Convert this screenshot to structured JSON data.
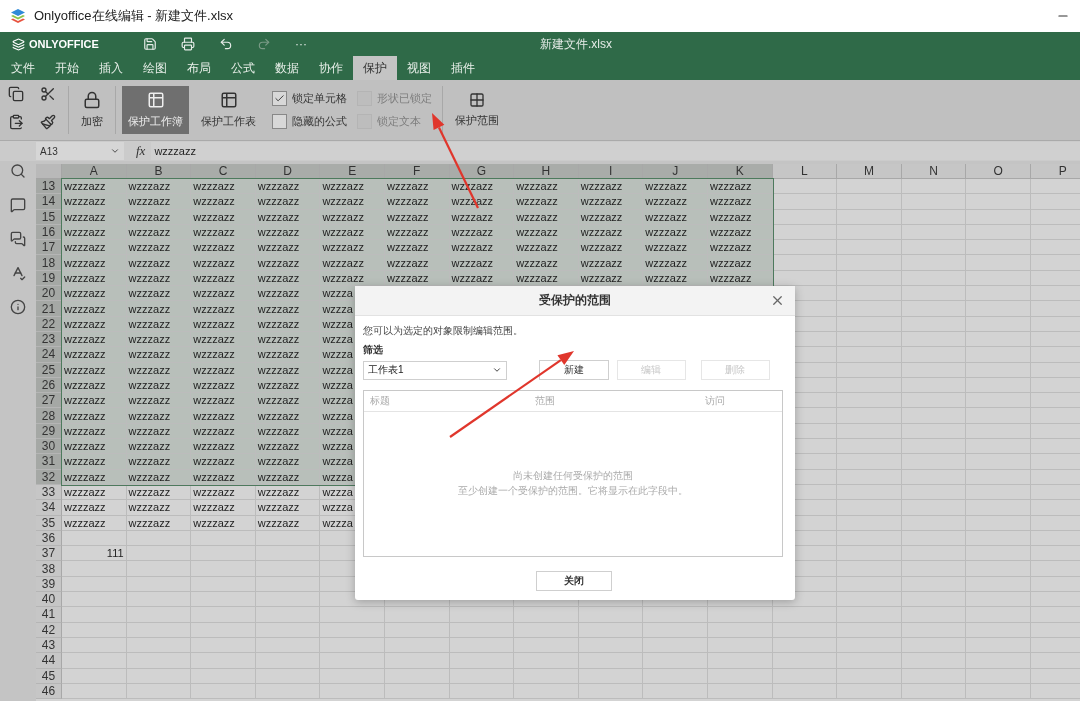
{
  "window": {
    "title": "Onlyoffice在线编辑 - 新建文件.xlsx"
  },
  "header": {
    "logo": "ONLYOFFICE",
    "document": "新建文件.xlsx",
    "more": "···",
    "quick_actions": [
      {
        "kind": "save",
        "disabled": false
      },
      {
        "kind": "print",
        "disabled": false
      },
      {
        "kind": "undo",
        "disabled": false
      },
      {
        "kind": "redo",
        "disabled": true
      }
    ]
  },
  "tabs": [
    {
      "label": "文件",
      "selected": false
    },
    {
      "label": "开始",
      "selected": false
    },
    {
      "label": "插入",
      "selected": false
    },
    {
      "label": "绘图",
      "selected": false
    },
    {
      "label": "布局",
      "selected": false
    },
    {
      "label": "公式",
      "selected": false
    },
    {
      "label": "数据",
      "selected": false
    },
    {
      "label": "协作",
      "selected": false
    },
    {
      "label": "保护",
      "selected": true
    },
    {
      "label": "视图",
      "selected": false
    },
    {
      "label": "插件",
      "selected": false
    }
  ],
  "toolbar": {
    "encrypt": "加密",
    "protect_range": "保护范围",
    "buttons": [
      {
        "label": "保护工作簿",
        "pressed": true
      },
      {
        "label": "保护工作表",
        "pressed": false
      }
    ],
    "options": [
      {
        "label": "锁定单元格",
        "checked": true,
        "disabled": false
      },
      {
        "label": "隐藏的公式",
        "checked": false,
        "disabled": false
      },
      {
        "label": "形状已锁定",
        "checked": false,
        "disabled": true
      },
      {
        "label": "锁定文本",
        "checked": false,
        "disabled": true
      }
    ]
  },
  "formula_bar": {
    "cell": "A13",
    "fx": "fx",
    "value": "wzzzazz"
  },
  "sheet": {
    "columns": [
      {
        "label": "A",
        "selected": true
      },
      {
        "label": "B",
        "selected": true
      },
      {
        "label": "C",
        "selected": true
      },
      {
        "label": "D",
        "selected": true
      },
      {
        "label": "E",
        "selected": true
      },
      {
        "label": "F",
        "selected": true
      },
      {
        "label": "G",
        "selected": true
      },
      {
        "label": "H",
        "selected": true
      },
      {
        "label": "I",
        "selected": true
      },
      {
        "label": "J",
        "selected": true
      },
      {
        "label": "K",
        "selected": true
      },
      {
        "label": "L",
        "selected": false
      },
      {
        "label": "M",
        "selected": false
      },
      {
        "label": "N",
        "selected": false
      },
      {
        "label": "O",
        "selected": false
      },
      {
        "label": "P",
        "selected": false
      }
    ],
    "rows": [
      {
        "header": "13",
        "selected": true,
        "cells": [
          "wzzzazz",
          "wzzzazz",
          "wzzzazz",
          "wzzzazz",
          "wzzzazz",
          "wzzzazz",
          "wzzzazz",
          "wzzzazz",
          "wzzzazz",
          "wzzzazz",
          "wzzzazz"
        ]
      },
      {
        "header": "14",
        "selected": true,
        "cells": [
          "wzzzazz",
          "wzzzazz",
          "wzzzazz",
          "wzzzazz",
          "wzzzazz",
          "wzzzazz",
          "wzzzazz",
          "wzzzazz",
          "wzzzazz",
          "wzzzazz",
          "wzzzazz"
        ]
      },
      {
        "header": "15",
        "selected": true,
        "cells": [
          "wzzzazz",
          "wzzzazz",
          "wzzzazz",
          "wzzzazz",
          "wzzzazz",
          "wzzzazz",
          "wzzzazz",
          "wzzzazz",
          "wzzzazz",
          "wzzzazz",
          "wzzzazz"
        ]
      },
      {
        "header": "16",
        "selected": true,
        "cells": [
          "wzzzazz",
          "wzzzazz",
          "wzzzazz",
          "wzzzazz",
          "wzzzazz",
          "wzzzazz",
          "wzzzazz",
          "wzzzazz",
          "wzzzazz",
          "wzzzazz",
          "wzzzazz"
        ]
      },
      {
        "header": "17",
        "selected": true,
        "cells": [
          "wzzzazz",
          "wzzzazz",
          "wzzzazz",
          "wzzzazz",
          "wzzzazz",
          "wzzzazz",
          "wzzzazz",
          "wzzzazz",
          "wzzzazz",
          "wzzzazz",
          "wzzzazz"
        ]
      },
      {
        "header": "18",
        "selected": true,
        "cells": [
          "wzzzazz",
          "wzzzazz",
          "wzzzazz",
          "wzzzazz",
          "wzzzazz",
          "wzzzazz",
          "wzzzazz",
          "wzzzazz",
          "wzzzazz",
          "wzzzazz",
          "wzzzazz"
        ]
      },
      {
        "header": "19",
        "selected": true,
        "cells": [
          "wzzzazz",
          "wzzzazz",
          "wzzzazz",
          "wzzzazz",
          "wzzzazz",
          "wzzzazz",
          "wzzzazz",
          "wzzzazz",
          "wzzzazz",
          "wzzzazz",
          "wzzzazz"
        ]
      },
      {
        "header": "20",
        "selected": true,
        "cells": [
          "wzzzazz",
          "wzzzazz",
          "wzzzazz",
          "wzzzazz",
          "wzzza"
        ]
      },
      {
        "header": "21",
        "selected": true,
        "cells": [
          "wzzzazz",
          "wzzzazz",
          "wzzzazz",
          "wzzzazz",
          "wzzza"
        ]
      },
      {
        "header": "22",
        "selected": true,
        "cells": [
          "wzzzazz",
          "wzzzazz",
          "wzzzazz",
          "wzzzazz",
          "wzzza"
        ]
      },
      {
        "header": "23",
        "selected": true,
        "cells": [
          "wzzzazz",
          "wzzzazz",
          "wzzzazz",
          "wzzzazz",
          "wzzza"
        ]
      },
      {
        "header": "24",
        "selected": true,
        "cells": [
          "wzzzazz",
          "wzzzazz",
          "wzzzazz",
          "wzzzazz",
          "wzzza"
        ]
      },
      {
        "header": "25",
        "selected": true,
        "cells": [
          "wzzzazz",
          "wzzzazz",
          "wzzzazz",
          "wzzzazz",
          "wzzza"
        ]
      },
      {
        "header": "26",
        "selected": true,
        "cells": [
          "wzzzazz",
          "wzzzazz",
          "wzzzazz",
          "wzzzazz",
          "wzzza"
        ]
      },
      {
        "header": "27",
        "selected": true,
        "cells": [
          "wzzzazz",
          "wzzzazz",
          "wzzzazz",
          "wzzzazz",
          "wzzza"
        ]
      },
      {
        "header": "28",
        "selected": true,
        "cells": [
          "wzzzazz",
          "wzzzazz",
          "wzzzazz",
          "wzzzazz",
          "wzzza"
        ]
      },
      {
        "header": "29",
        "selected": true,
        "cells": [
          "wzzzazz",
          "wzzzazz",
          "wzzzazz",
          "wzzzazz",
          "wzzza"
        ]
      },
      {
        "header": "30",
        "selected": true,
        "cells": [
          "wzzzazz",
          "wzzzazz",
          "wzzzazz",
          "wzzzazz",
          "wzzza"
        ]
      },
      {
        "header": "31",
        "selected": true,
        "cells": [
          "wzzzazz",
          "wzzzazz",
          "wzzzazz",
          "wzzzazz",
          "wzzza"
        ]
      },
      {
        "header": "32",
        "selected": true,
        "cells": [
          "wzzzazz",
          "wzzzazz",
          "wzzzazz",
          "wzzzazz",
          "wzzza"
        ]
      },
      {
        "header": "33",
        "selected": false,
        "cells": [
          "wzzzazz",
          "wzzzazz",
          "wzzzazz",
          "wzzzazz",
          "wzzza"
        ]
      },
      {
        "header": "34",
        "selected": false,
        "cells": [
          "wzzzazz",
          "wzzzazz",
          "wzzzazz",
          "wzzzazz",
          "wzzza"
        ]
      },
      {
        "header": "35",
        "selected": false,
        "cells": [
          "wzzzazz",
          "wzzzazz",
          "wzzzazz",
          "wzzzazz",
          "wzzza"
        ]
      },
      {
        "header": "36",
        "selected": false,
        "cells": []
      },
      {
        "header": "37",
        "selected": false,
        "cells": [
          {
            "text": "111",
            "kind": "number"
          }
        ]
      },
      {
        "header": "38",
        "selected": false,
        "cells": []
      },
      {
        "header": "39",
        "selected": false,
        "cells": []
      },
      {
        "header": "40",
        "selected": false,
        "cells": []
      },
      {
        "header": "41",
        "selected": false,
        "cells": []
      },
      {
        "header": "42",
        "selected": false,
        "cells": []
      },
      {
        "header": "43",
        "selected": false,
        "cells": []
      },
      {
        "header": "44",
        "selected": false,
        "cells": []
      },
      {
        "header": "45",
        "selected": false,
        "cells": []
      },
      {
        "header": "46",
        "selected": false,
        "cells": []
      }
    ]
  },
  "dialog": {
    "title": "受保护的范围",
    "description": "您可以为选定的对象限制编辑范围。",
    "filter_label": "筛选",
    "filter_value": "工作表1",
    "buttons": [
      {
        "label": "新建",
        "disabled": false
      },
      {
        "label": "编辑",
        "disabled": true
      },
      {
        "label": "删除",
        "disabled": true
      }
    ],
    "columns": [
      "标题",
      "范围",
      "访问"
    ],
    "empty_lines": [
      "尚未创建任何受保护的范围",
      "至少创建一个受保护的范围。它将显示在此字段中。"
    ],
    "close": "关闭"
  },
  "annotations": [
    {
      "kind": "arrow"
    },
    {
      "kind": "arrow"
    }
  ]
}
